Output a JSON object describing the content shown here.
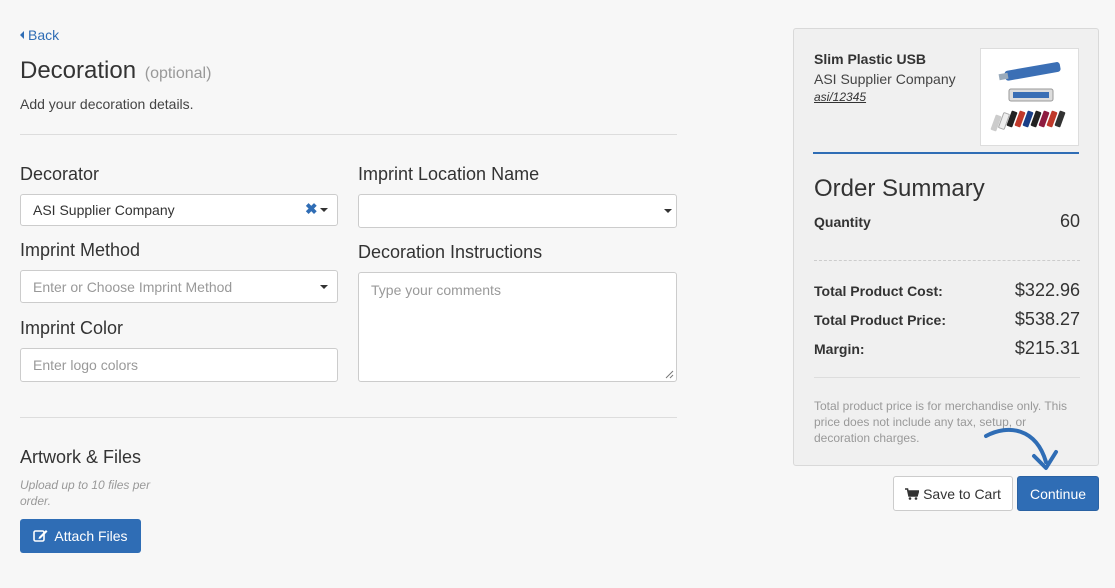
{
  "nav": {
    "back_label": "Back"
  },
  "header": {
    "title": "Decoration",
    "optional": "(optional)",
    "subtitle": "Add your decoration details."
  },
  "form": {
    "decorator": {
      "label": "Decorator",
      "value": "ASI Supplier Company"
    },
    "imprint_location": {
      "label": "Imprint Location Name",
      "value": ""
    },
    "imprint_method": {
      "label": "Imprint Method",
      "placeholder": "Enter or Choose Imprint Method"
    },
    "decoration_instructions": {
      "label": "Decoration Instructions",
      "placeholder": "Type your comments"
    },
    "imprint_color": {
      "label": "Imprint Color",
      "placeholder": "Enter logo colors"
    }
  },
  "artwork": {
    "title": "Artwork & Files",
    "note": "Upload up to 10 files per order.",
    "attach_label": "Attach Files"
  },
  "product": {
    "name": "Slim Plastic USB",
    "supplier": "ASI Supplier Company",
    "id": "asi/12345",
    "image_icon": "usb-product-image"
  },
  "summary": {
    "title": "Order Summary",
    "quantity_label": "Quantity",
    "quantity": "60",
    "total_cost_label": "Total Product Cost:",
    "total_cost": "$322.96",
    "total_price_label": "Total Product Price:",
    "total_price": "$538.27",
    "margin_label": "Margin:",
    "margin": "$215.31",
    "disclaimer": "Total product price is for merchandise only. This price does not include any tax, setup, or decoration charges."
  },
  "actions": {
    "save_label": "Save to Cart",
    "continue_label": "Continue"
  },
  "colors": {
    "accent": "#2f6db5",
    "background": "#f7f7f7"
  }
}
